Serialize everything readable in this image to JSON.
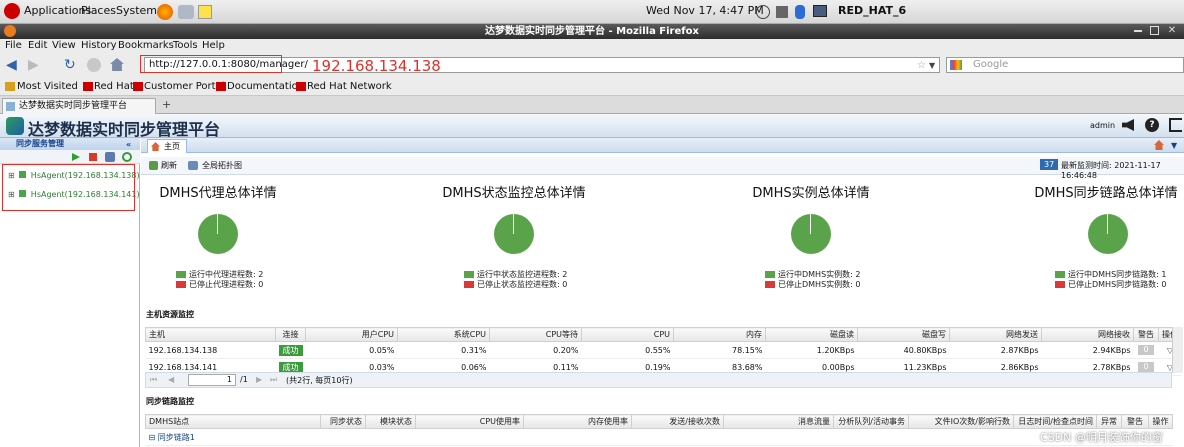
{
  "gnome": {
    "applications": "Applications",
    "places": "Places",
    "system": "System",
    "datetime": "Wed Nov 17,  4:47 PM",
    "hostname": "RED_HAT_6"
  },
  "window": {
    "title": "达梦数据实时同步管理平台 - Mozilla Firefox"
  },
  "menu": [
    "File",
    "Edit",
    "View",
    "History",
    "Bookmarks",
    "Tools",
    "Help"
  ],
  "nav": {
    "url": "http://127.0.0.1:8080/manager/",
    "ip_annotation": "192.168.134.138",
    "search_placeholder": "Google"
  },
  "bookmarks": [
    "Most Visited",
    "Red Hat",
    "Customer Portal",
    "Documentation",
    "Red Hat Network"
  ],
  "tab": {
    "title": "达梦数据实时同步管理平台"
  },
  "app": {
    "title": "达梦数据实时同步管理平台",
    "user": "admin"
  },
  "sidebar": {
    "title": "同步服务管理",
    "agents": [
      "HsAgent(192.168.134.138)",
      "HsAgent(192.168.134.141)"
    ]
  },
  "main": {
    "tab": "主页",
    "refresh": "刷新",
    "topology": "全局拓扑图",
    "count_badge": "37",
    "last_monitor": "最新监测时间: 2021-11-17 16:46:48",
    "panels": [
      {
        "title": "DMHS代理总体详情",
        "legend_running": "运行中代理进程数: 2",
        "legend_stopped": "已停止代理进程数: 0"
      },
      {
        "title": "DMHS状态监控总体详情",
        "legend_running": "运行中状态监控进程数: 2",
        "legend_stopped": "已停止状态监控进程数: 0"
      },
      {
        "title": "DMHS实例总体详情",
        "legend_running": "运行中DMHS实例数: 2",
        "legend_stopped": "已停止DMHS实例数: 0"
      },
      {
        "title": "DMHS同步链路总体详情",
        "legend_running": "运行中DMHS同步链路数: 1",
        "legend_stopped": "已停止DMHS同步链路数: 0"
      }
    ]
  },
  "host_monitor": {
    "title": "主机资源监控",
    "columns": [
      "主机",
      "连接",
      "用户CPU",
      "系统CPU",
      "CPU等待",
      "CPU",
      "内存",
      "磁盘读",
      "磁盘写",
      "网络发送",
      "网络接收",
      "警告",
      "操作"
    ],
    "rows": [
      [
        "192.168.134.138",
        "成功",
        "0.05%",
        "0.31%",
        "0.20%",
        "0.55%",
        "78.15%",
        "1.20KBps",
        "40.80KBps",
        "2.87KBps",
        "2.94KBps",
        "0",
        ""
      ],
      [
        "192.168.134.141",
        "成功",
        "0.03%",
        "0.06%",
        "0.11%",
        "0.19%",
        "83.68%",
        "0.00Bps",
        "11.23KBps",
        "2.86KBps",
        "2.78KBps",
        "0",
        ""
      ]
    ],
    "pager": {
      "page": "1",
      "of": "/1",
      "summary": "(共2行, 每页10行)"
    }
  },
  "link_monitor": {
    "title": "同步链路监控",
    "columns": [
      "DMHS站点",
      "同步状态",
      "模块状态",
      "CPU使用率",
      "内存使用率",
      "发送/接收次数",
      "消息流量",
      "分析队列/活动事务",
      "文件IO次数/影响行数",
      "日志时间/检查点时间",
      "异常",
      "警告",
      "操作"
    ],
    "group": "同步链路1"
  },
  "watermark": "CSDN @明月装饰你的窗"
}
